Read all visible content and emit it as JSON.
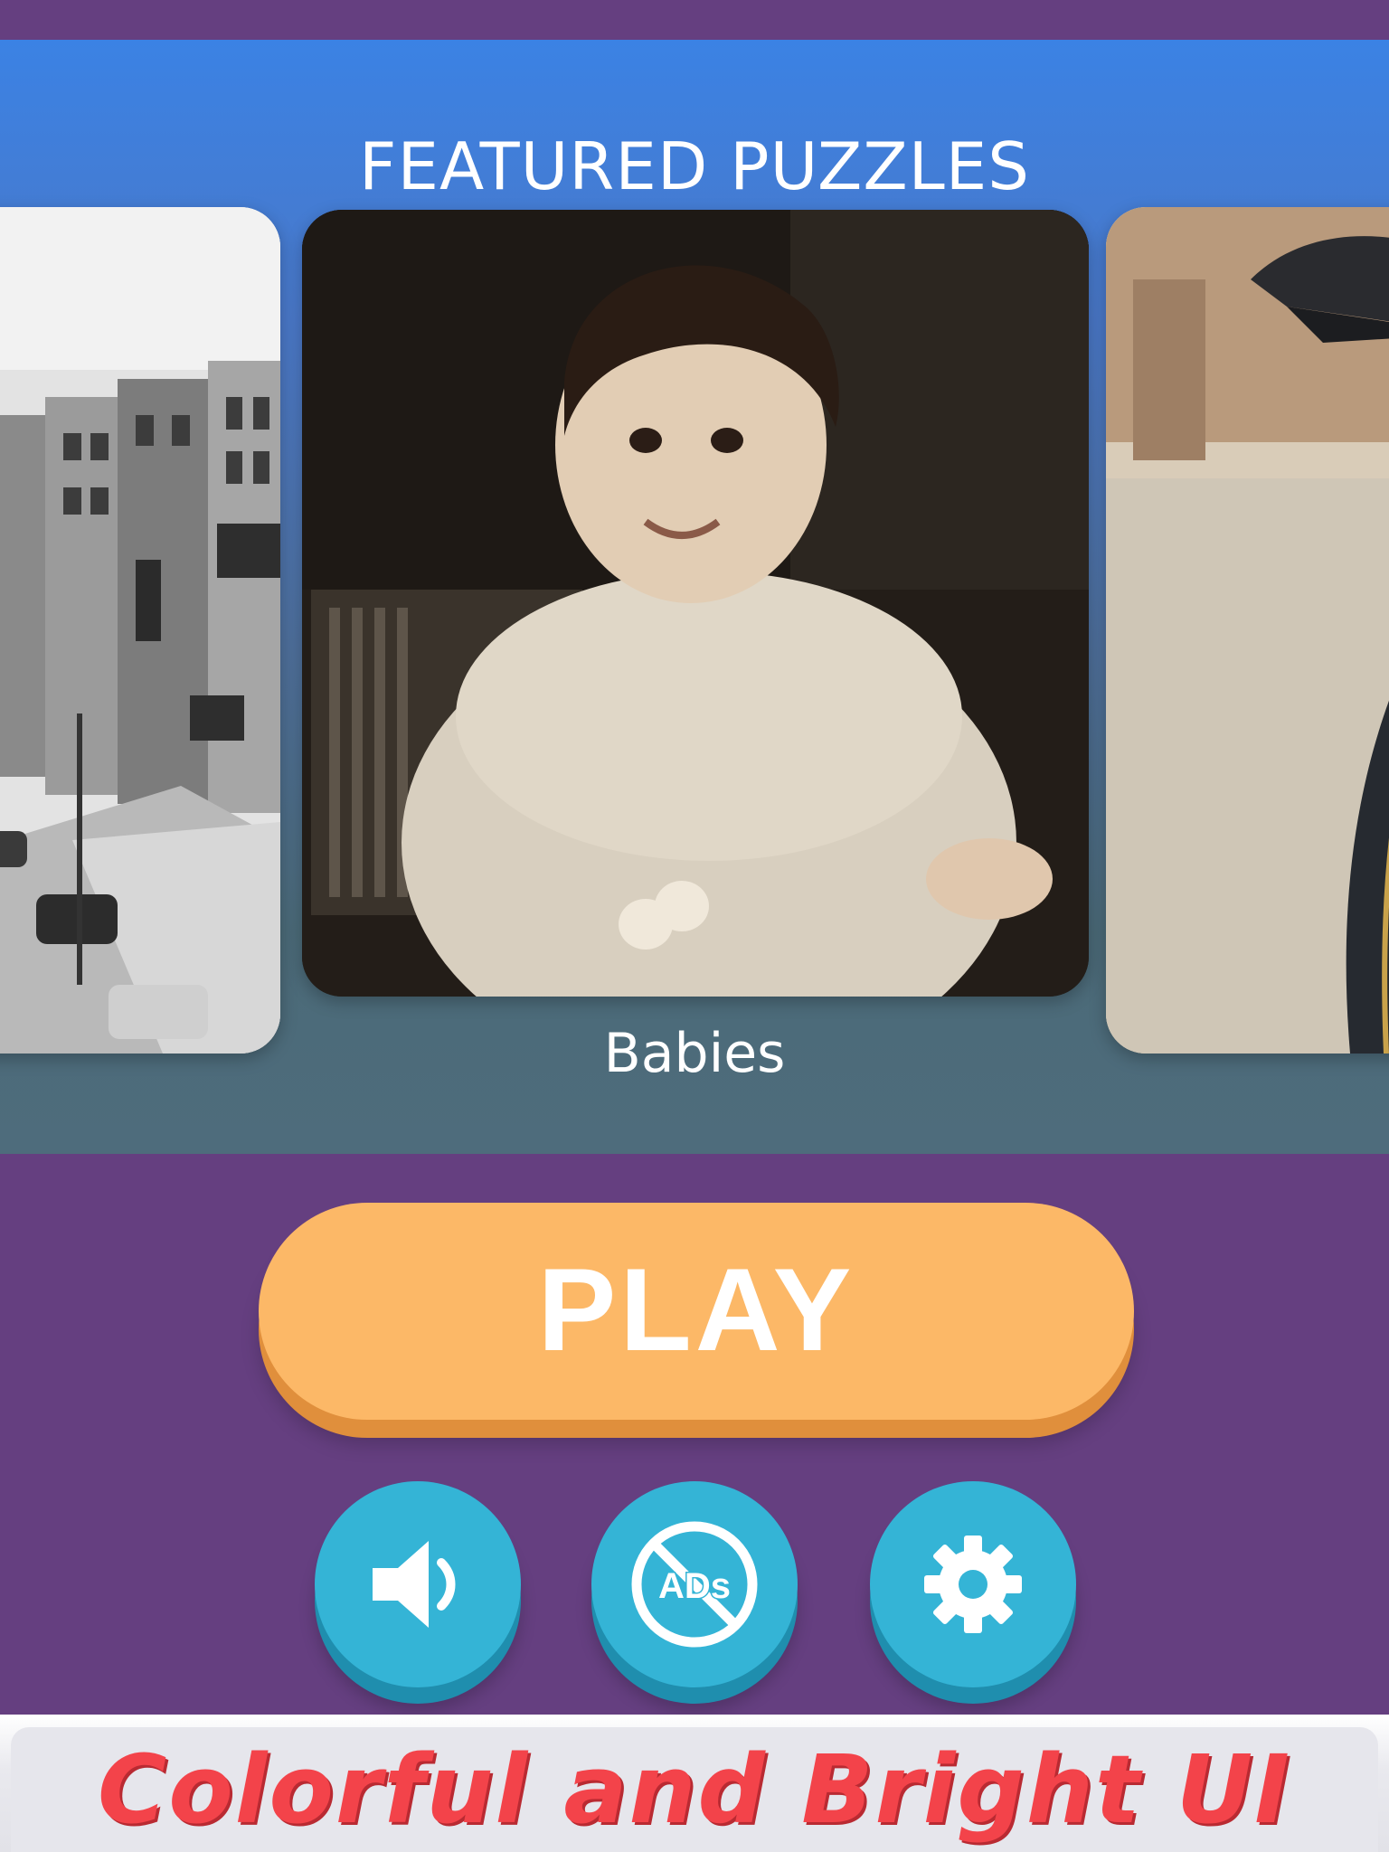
{
  "featured": {
    "title": "FEATURED PUZZLES",
    "cards": [
      {
        "id": "left",
        "subject": "vintage-city-street-photo"
      },
      {
        "id": "center",
        "subject": "vintage-baby-photo",
        "caption": "Babies"
      },
      {
        "id": "right",
        "subject": "car-side-mirror-photo"
      }
    ]
  },
  "play": {
    "label": "PLAY"
  },
  "buttons": {
    "sound_icon": "speaker-icon",
    "ads_icon": "no-ads-icon",
    "ads_text": "ADs",
    "settings_icon": "gear-icon"
  },
  "promo": {
    "text": "Colorful and Bright UI"
  },
  "colors": {
    "background": "#653f80",
    "play_button": "#fcb867",
    "round_button": "#34b4d6",
    "promo_text": "#f3434a"
  }
}
